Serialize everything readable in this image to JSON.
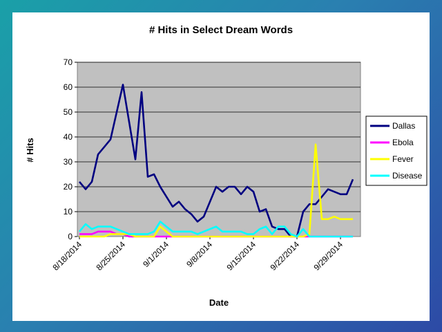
{
  "chart_data": {
    "type": "line",
    "title": "# Hits in Select Dream Words",
    "xlabel": "Date",
    "ylabel": "# Hits",
    "ylim": [
      0,
      70
    ],
    "yticks": [
      0,
      10,
      20,
      30,
      40,
      50,
      60,
      70
    ],
    "x_tick_labels": [
      "8/18/2014",
      "8/25/2014",
      "9/1/2014",
      "9/8/2014",
      "9/15/2014",
      "9/22/2014",
      "9/29/2014"
    ],
    "x": [
      "8/18/2014",
      "8/19/2014",
      "8/20/2014",
      "8/21/2014",
      "8/22/2014",
      "8/23/2014",
      "8/24/2014",
      "8/25/2014",
      "8/26/2014",
      "8/27/2014",
      "8/28/2014",
      "8/29/2014",
      "8/30/2014",
      "8/31/2014",
      "9/1/2014",
      "9/2/2014",
      "9/3/2014",
      "9/4/2014",
      "9/5/2014",
      "9/6/2014",
      "9/7/2014",
      "9/8/2014",
      "9/9/2014",
      "9/10/2014",
      "9/11/2014",
      "9/12/2014",
      "9/13/2014",
      "9/14/2014",
      "9/15/2014",
      "9/16/2014",
      "9/17/2014",
      "9/18/2014",
      "9/19/2014",
      "9/20/2014",
      "9/21/2014",
      "9/22/2014",
      "9/23/2014",
      "9/24/2014",
      "9/25/2014",
      "9/26/2014",
      "9/27/2014",
      "9/28/2014",
      "9/29/2014",
      "9/30/2014",
      "10/1/2014",
      "10/2/2014",
      "10/3/2014"
    ],
    "grid": true,
    "legend_position": "right",
    "plot_background": "#c0c0c0",
    "series": [
      {
        "name": "Dallas",
        "color": "#000080",
        "values": [
          22,
          19,
          22,
          33,
          36,
          39,
          50,
          61,
          46,
          31,
          58,
          24,
          25,
          20,
          16,
          12,
          14,
          11,
          9,
          6,
          8,
          14,
          20,
          18,
          20,
          20,
          17,
          20,
          18,
          10,
          11,
          4,
          3,
          3,
          0,
          0,
          10,
          13,
          13,
          16,
          19,
          18,
          17,
          17,
          23
        ]
      },
      {
        "name": "Ebola",
        "color": "#ff00ff",
        "values": [
          1,
          1,
          1,
          2,
          2,
          2,
          1,
          1,
          0,
          0,
          0,
          0,
          0,
          0,
          0,
          0,
          0,
          0,
          0,
          0,
          0,
          0,
          0,
          0,
          0,
          0,
          0,
          0,
          0,
          0,
          0,
          0,
          0,
          0,
          0,
          0,
          0,
          0,
          0,
          0,
          0,
          0,
          0,
          0,
          0
        ]
      },
      {
        "name": "Fever",
        "color": "#ffff00",
        "values": [
          0,
          0,
          0,
          0,
          0,
          1,
          1,
          1,
          1,
          0,
          0,
          0,
          0,
          4,
          2,
          0,
          0,
          0,
          0,
          0,
          0,
          0,
          0,
          0,
          0,
          0,
          0,
          0,
          0,
          0,
          0,
          0,
          0,
          0,
          0,
          0,
          0,
          1,
          37,
          7,
          7,
          8,
          7,
          7,
          7
        ]
      },
      {
        "name": "Disease",
        "color": "#00ffff",
        "values": [
          2,
          5,
          3,
          4,
          4,
          4,
          3,
          2,
          1,
          1,
          1,
          1,
          2,
          6,
          4,
          2,
          2,
          2,
          2,
          1,
          2,
          3,
          4,
          2,
          2,
          2,
          2,
          1,
          1,
          3,
          4,
          1,
          4,
          4,
          1,
          0,
          3,
          0,
          0,
          0,
          0,
          0,
          0,
          0,
          0
        ]
      }
    ]
  }
}
